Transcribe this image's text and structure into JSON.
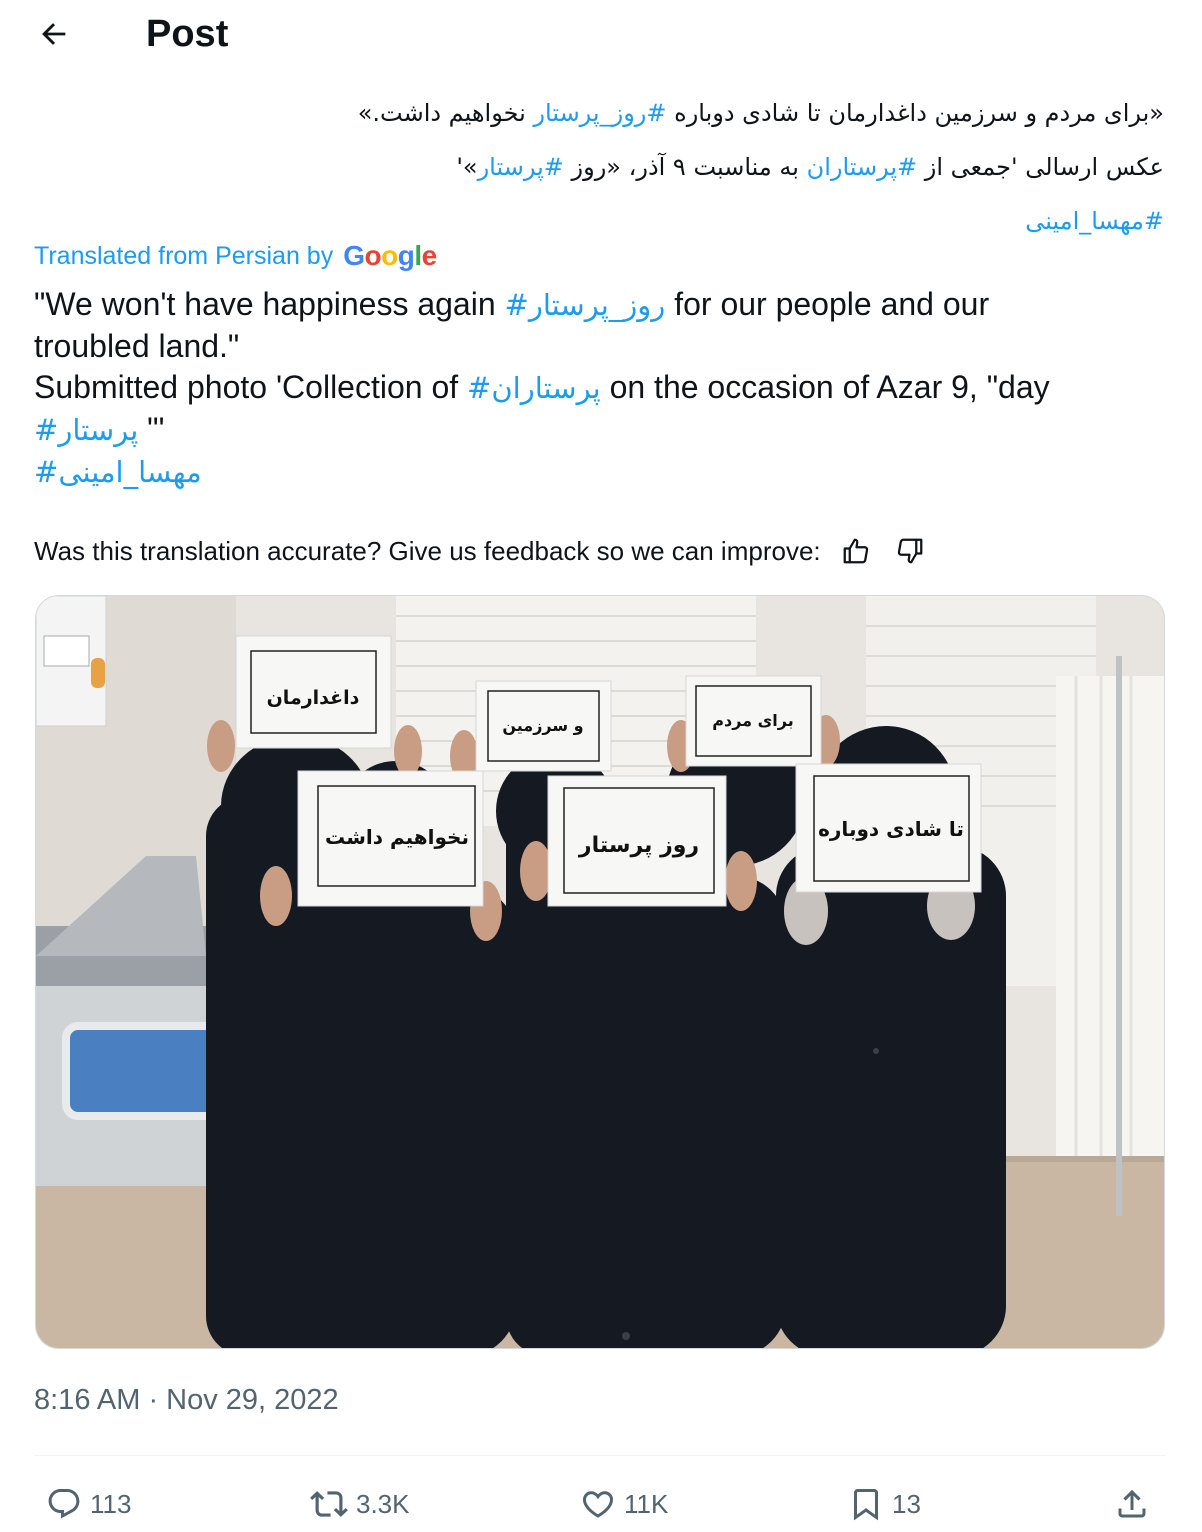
{
  "header": {
    "title": "Post"
  },
  "tweet": {
    "original_lines": [
      [
        {
          "t": "«برای مردم و سرزمین داغدارمان تا شادی دوباره ",
          "tag": false
        },
        {
          "t": "#روز_پرستار",
          "tag": true
        },
        {
          "t": " نخواهیم داشت.»",
          "tag": false
        }
      ],
      [
        {
          "t": "عکس ارسالی 'جمعی از ",
          "tag": false
        },
        {
          "t": "#پرستاران",
          "tag": true
        },
        {
          "t": " به مناسبت ۹ آذر، «روز ",
          "tag": false
        },
        {
          "t": "#پرستار",
          "tag": true
        },
        {
          "t": "»'",
          "tag": false
        }
      ],
      [
        {
          "t": "#مهسا_امینی",
          "tag": true
        }
      ]
    ],
    "translated_label": "Translated from Persian by",
    "google_letters": [
      "G",
      "o",
      "o",
      "g",
      "l",
      "e"
    ],
    "translation_lines": [
      [
        {
          "t": "\"We won't have happiness again ",
          "tag": false
        },
        {
          "t": "#روز_پرستار",
          "tag": true
        },
        {
          "t": " for our people and our",
          "tag": false
        }
      ],
      [
        {
          "t": "troubled land.\"",
          "tag": false
        }
      ],
      [
        {
          "t": "Submitted photo 'Collection of ",
          "tag": false
        },
        {
          "t": "#پرستاران",
          "tag": true
        },
        {
          "t": " on the occasion of Azar 9, \"day",
          "tag": false
        }
      ],
      [
        {
          "t": "#پرستار",
          "tag": true
        },
        {
          "t": " \"'",
          "tag": false
        }
      ],
      [
        {
          "t": "#مهسا_امینی",
          "tag": true
        }
      ]
    ],
    "feedback_text": "Was this translation accurate? Give us feedback so we can improve:",
    "signs": {
      "s1": "داغدارمان",
      "s2": "و سرزمین",
      "s3": "برای مردم",
      "s4": "نخواهیم داشت",
      "s5": "روز پرستار",
      "s6": "تا شادی دوباره"
    },
    "timestamp": "8:16 AM · Nov 29, 2022"
  },
  "actions": {
    "replies": "113",
    "reposts": "3.3K",
    "likes": "11K",
    "bookmarks": "13"
  },
  "colors": {
    "accent": "#1d9bf0",
    "text": "#0f1419",
    "muted": "#536471"
  },
  "icons": [
    "back-arrow-icon",
    "thumbs-up-icon",
    "thumbs-down-icon",
    "reply-icon",
    "repost-icon",
    "like-icon",
    "bookmark-icon",
    "share-icon"
  ]
}
